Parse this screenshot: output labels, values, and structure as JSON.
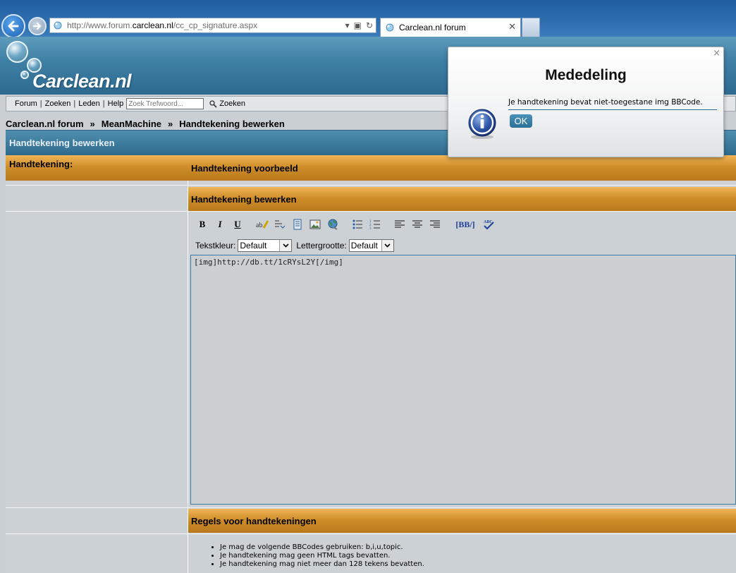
{
  "browser": {
    "url_prefix": "http://www.forum.",
    "url_domain": "carclean.nl",
    "url_suffix": "/cc_cp_signature.aspx",
    "tab_title": "Carclean.nl forum"
  },
  "site": {
    "logo": "Carclean.nl",
    "nav": {
      "items": [
        "Forum",
        "Zoeken",
        "Leden",
        "Help"
      ],
      "search_placeholder": "Zoek Trefwoord...",
      "search_button": "Zoeken"
    },
    "breadcrumb": [
      "Carclean.nl forum",
      "MeanMachine",
      "Handtekening bewerken"
    ],
    "breadcrumb_separator": "»",
    "section_title": "Handtekening bewerken"
  },
  "form": {
    "signature_label": "Handtekening:",
    "preview_header": "Handtekening voorbeeld",
    "edit_header": "Handtekening bewerken",
    "text_color_label": "Tekstkleur:",
    "text_color_value": "Default",
    "font_size_label": "Lettergrootte:",
    "font_size_value": "Default",
    "signature_value": "[img]http://db.tt/1cRYsL2Y[/img]",
    "toolbar": {
      "bold": "B",
      "italic": "I",
      "underline": "U",
      "bbcode": "[BB/]"
    }
  },
  "rules": {
    "header": "Regels voor handtekeningen",
    "items": [
      "Je mag de volgende BBCodes gebruiken: b,i,u,topic.",
      "Je handtekening mag geen HTML tags bevatten.",
      "Je handtekening mag niet meer dan 128 tekens bevatten."
    ]
  },
  "dialog": {
    "title": "Mededeling",
    "message": "Je handtekening bevat niet-toegestane img BBCode.",
    "ok_label": "OK",
    "close_glyph": "×"
  },
  "colors": {
    "header_blue": "#2e6a90",
    "orange": "#cf8e2a",
    "panel_gray": "#cbd1d5"
  }
}
